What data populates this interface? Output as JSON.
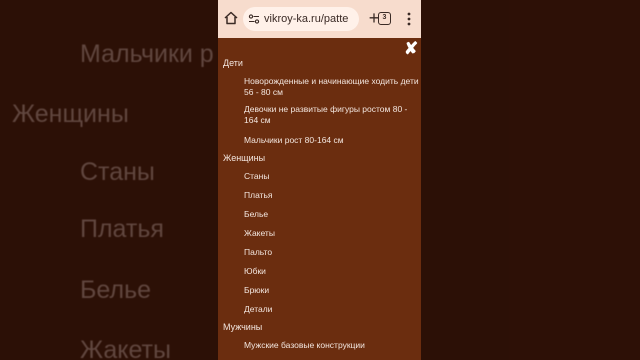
{
  "background": {
    "items": [
      "Мальчики р",
      "Женщины",
      "Станы",
      "Платья",
      "Белье",
      "Жакеты"
    ]
  },
  "browser": {
    "url": "vikroy-ka.ru/patte",
    "tab_count": "3"
  },
  "menu": {
    "sections": [
      {
        "title": "Дети",
        "items": [
          "Новорожденные и начинающие ходить дети 56 - 80 см",
          "Девочки не развитые фигуры ростом 80 - 164 см",
          "Мальчики рост 80-164 см"
        ]
      },
      {
        "title": "Женщины",
        "items": [
          "Станы",
          "Платья",
          "Белье",
          "Жакеты",
          "Пальто",
          "Юбки",
          "Брюки",
          "Детали"
        ]
      },
      {
        "title": "Мужчины",
        "items": [
          "Мужские базовые конструкции"
        ]
      }
    ]
  },
  "colors": {
    "panel": "#6b2d0f",
    "url_bar": "#f7dccd",
    "text": "#f3e6df"
  }
}
